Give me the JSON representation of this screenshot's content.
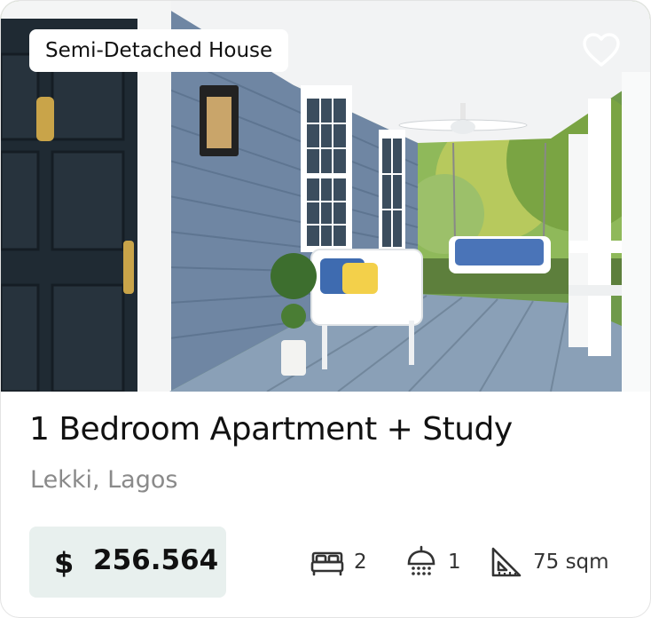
{
  "listing": {
    "badge": "Semi-Detached House",
    "title": "1 Bedroom Apartment + Study",
    "location": "Lekki, Lagos",
    "price_currency": "$",
    "price_value": "256.564",
    "features": {
      "bedrooms": "2",
      "bathrooms": "1",
      "area": "75 sqm"
    },
    "favorite_icon": "heart-outline-icon",
    "colors": {
      "price_bg": "#e8f0ee",
      "location_text": "#8a8a8a",
      "icon": "#333333"
    }
  }
}
